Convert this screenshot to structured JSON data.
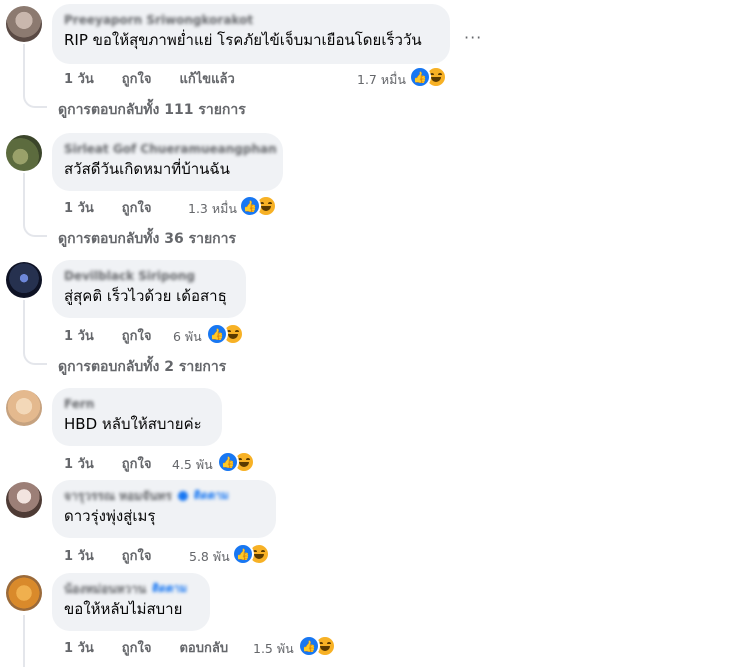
{
  "comments": [
    {
      "name": "Preeyaporn Sriwongkorakot",
      "text": "RIP ขอให้สุขภาพย่ำแย่ โรคภัยไข้เจ็บมาเยือนโดยเร็ววัน",
      "time": "1 วัน",
      "like": "ถูกใจ",
      "extra": "แก้ไขแล้ว",
      "reaction_count": "1.7 หมื่น",
      "view_replies": "ดูการตอบกลับทั้ง 111 รายการ"
    },
    {
      "name": "Sirleat Gof Chueramueangphan",
      "text": "สวัสดีวันเกิดหมาที่บ้านฉัน",
      "time": "1 วัน",
      "like": "ถูกใจ",
      "reaction_count": "1.3 หมื่น",
      "view_replies": "ดูการตอบกลับทั้ง 36 รายการ"
    },
    {
      "name": "Devilblack Siripong",
      "text": "สู่สุคติ เร็วไวด้วย เด้อสาธุ",
      "time": "1 วัน",
      "like": "ถูกใจ",
      "reaction_count": "6 พัน",
      "view_replies": "ดูการตอบกลับทั้ง 2 รายการ"
    },
    {
      "name": "Fern",
      "text": "HBD หลับให้สบายค่ะ",
      "time": "1 วัน",
      "like": "ถูกใจ",
      "reaction_count": "4.5 พัน"
    },
    {
      "name": "จารุวรรณ หอมจันทร",
      "follow": "ติดตาม",
      "text": "ดาวรุ่งพุ่งสู่เมรุ",
      "time": "1 วัน",
      "like": "ถูกใจ",
      "reaction_count": "5.8 พัน"
    },
    {
      "name": "น้องหม่อนหวาน",
      "follow": "ติดตาม",
      "text": "ขอให้หลับไม่สบาย",
      "time": "1 วัน",
      "like": "ถูกใจ",
      "extra": "ตอบกลับ",
      "reaction_count": "1.5 พัน"
    }
  ],
  "more_menu": "···",
  "reaction_icons": [
    "like-icon",
    "haha-icon"
  ],
  "colors": {
    "link_blue": "#1877f2",
    "bubble": "#f0f2f5",
    "meta": "#65676b"
  }
}
